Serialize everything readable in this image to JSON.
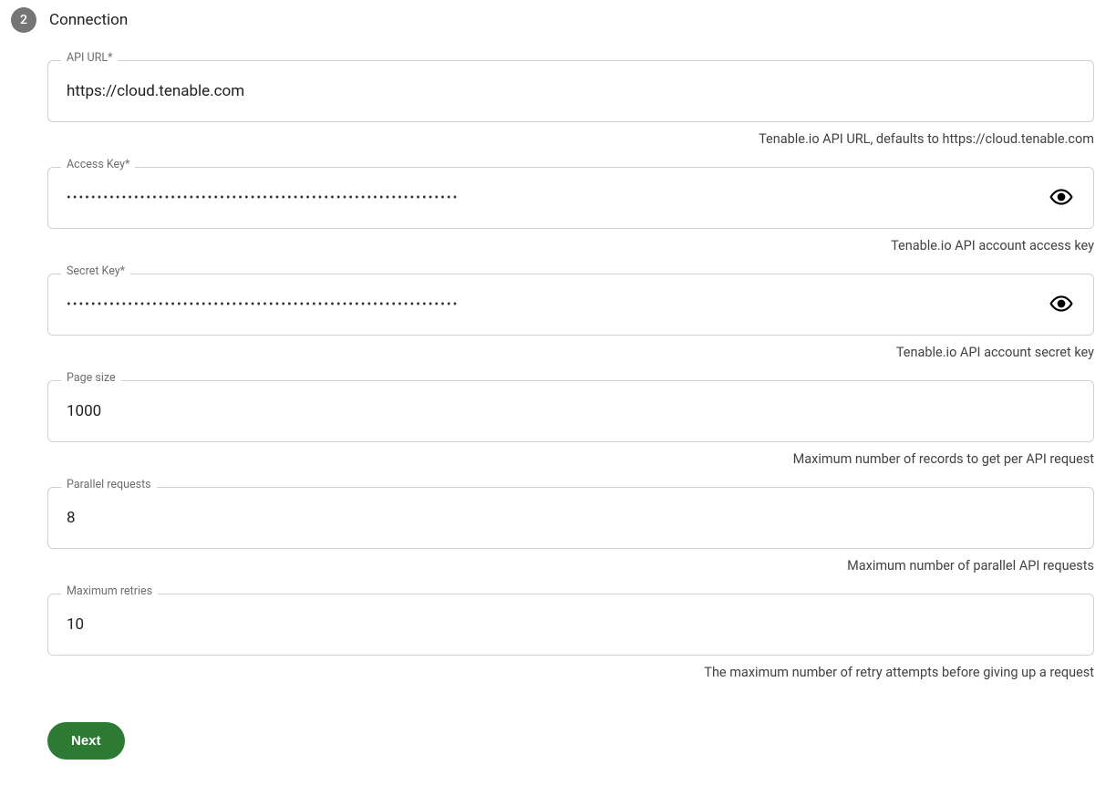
{
  "step": {
    "number": "2",
    "title": "Connection"
  },
  "fields": {
    "api_url": {
      "label": "API URL*",
      "value": "https://cloud.tenable.com",
      "helper": "Tenable.io API URL, defaults to https://cloud.tenable.com"
    },
    "access_key": {
      "label": "Access Key*",
      "value": "••••••••••••••••••••••••••••••••••••••••••••••••••••••••••••••••",
      "helper": "Tenable.io API account access key"
    },
    "secret_key": {
      "label": "Secret Key*",
      "value": "••••••••••••••••••••••••••••••••••••••••••••••••••••••••••••••••",
      "helper": "Tenable.io API account secret key"
    },
    "page_size": {
      "label": "Page size",
      "value": "1000",
      "helper": "Maximum number of records to get per API request"
    },
    "parallel_requests": {
      "label": "Parallel requests",
      "value": "8",
      "helper": "Maximum number of parallel API requests"
    },
    "max_retries": {
      "label": "Maximum retries",
      "value": "10",
      "helper": "The maximum number of retry attempts before giving up a request"
    }
  },
  "actions": {
    "next_label": "Next"
  }
}
